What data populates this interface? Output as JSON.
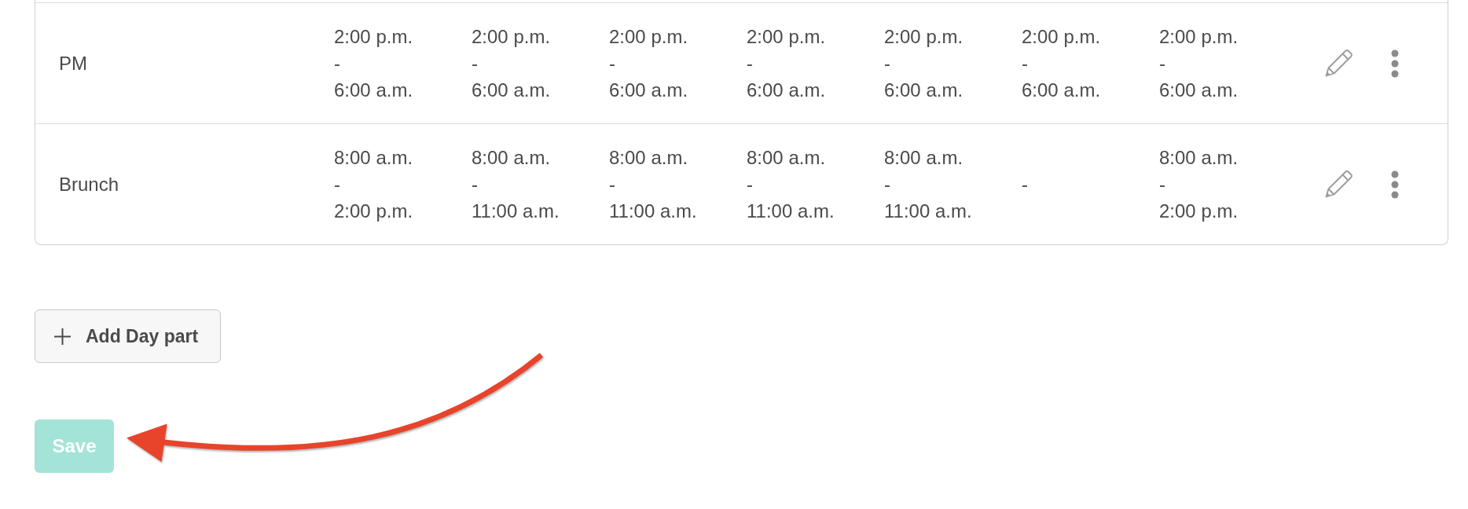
{
  "schedule": {
    "rows": [
      {
        "name": "PM",
        "cells": [
          {
            "start": "2:00 p.m.",
            "separator": "-",
            "end": "6:00 a.m."
          },
          {
            "start": "2:00 p.m.",
            "separator": "-",
            "end": "6:00 a.m."
          },
          {
            "start": "2:00 p.m.",
            "separator": "-",
            "end": "6:00 a.m."
          },
          {
            "start": "2:00 p.m.",
            "separator": "-",
            "end": "6:00 a.m."
          },
          {
            "start": "2:00 p.m.",
            "separator": "-",
            "end": "6:00 a.m."
          },
          {
            "start": "2:00 p.m.",
            "separator": "-",
            "end": "6:00 a.m."
          },
          {
            "start": "2:00 p.m.",
            "separator": "-",
            "end": "6:00 a.m."
          }
        ]
      },
      {
        "name": "Brunch",
        "cells": [
          {
            "start": "8:00 a.m.",
            "separator": "-",
            "end": "2:00 p.m."
          },
          {
            "start": "8:00 a.m.",
            "separator": "-",
            "end": "11:00 a.m."
          },
          {
            "start": "8:00 a.m.",
            "separator": "-",
            "end": "11:00 a.m."
          },
          {
            "start": "8:00 a.m.",
            "separator": "-",
            "end": "11:00 a.m."
          },
          {
            "start": "8:00 a.m.",
            "separator": "-",
            "end": "11:00 a.m."
          },
          {
            "separator": "-"
          },
          {
            "start": "8:00 a.m.",
            "separator": "-",
            "end": "2:00 p.m."
          }
        ]
      }
    ]
  },
  "add_button": {
    "label": "Add Day part"
  },
  "save_button": {
    "label": "Save",
    "disabled": true
  },
  "annotations": [
    {
      "kind": "arrow"
    }
  ]
}
